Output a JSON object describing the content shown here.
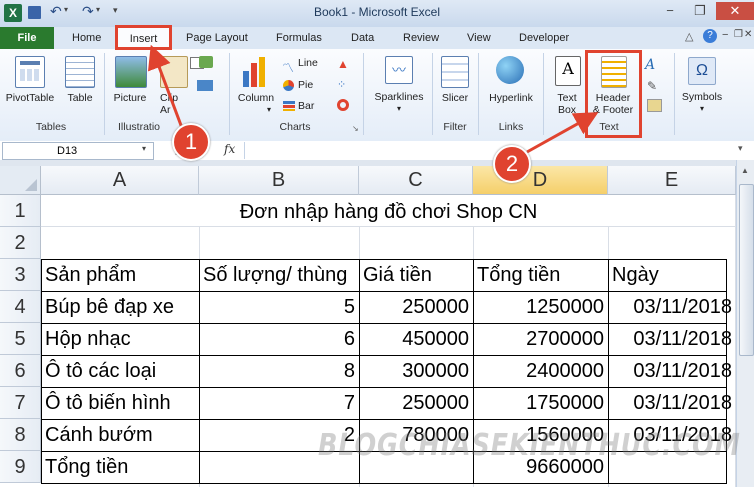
{
  "window": {
    "title": "Book1 - Microsoft Excel",
    "minimize": "−",
    "restore": "❐",
    "close": "✕"
  },
  "tabs": {
    "file": "File",
    "items": [
      "Home",
      "Insert",
      "Page Layout",
      "Formulas",
      "Data",
      "Review",
      "View",
      "Developer"
    ],
    "active": "Insert"
  },
  "ribbon": {
    "tables": {
      "group": "Tables",
      "pivot": "PivotTable",
      "table": "Table"
    },
    "illustrations": {
      "group": "Illustratio",
      "picture": "Picture",
      "clipart": "Clip Ar"
    },
    "charts": {
      "group": "Charts",
      "column": "Column",
      "line": "Line",
      "pie": "Pie",
      "bar": "Bar"
    },
    "sparklines": {
      "label": "Sparklines"
    },
    "filter": {
      "group": "Filter",
      "slicer": "Slicer"
    },
    "links": {
      "group": "Links",
      "hyperlink": "Hyperlink"
    },
    "text": {
      "group": "Text",
      "textbox_1": "Text",
      "textbox_2": "Box",
      "hf_1": "Header",
      "hf_2": "& Footer"
    },
    "symbols": {
      "label": "Symbols",
      "omega": "Ω"
    }
  },
  "formula_bar": {
    "name_box": "D13",
    "fx": "fx",
    "value": ""
  },
  "columns": [
    "A",
    "B",
    "C",
    "D",
    "E"
  ],
  "selected_column": "D",
  "rows": [
    {
      "n": "1",
      "title": "Đơn nhập hàng đồ chơi Shop CN"
    },
    {
      "n": "2"
    },
    {
      "n": "3",
      "cells": [
        "Sản phẩm",
        "Số lượng/ thùng",
        "Giá tiền",
        "Tổng tiền",
        "Ngày"
      ]
    },
    {
      "n": "4",
      "cells": [
        "Búp bê đạp xe",
        "5",
        "250000",
        "1250000",
        "03/11/2018"
      ]
    },
    {
      "n": "5",
      "cells": [
        "Hộp nhạc",
        "6",
        "450000",
        "2700000",
        "03/11/2018"
      ]
    },
    {
      "n": "6",
      "cells": [
        "Ô tô các loại",
        "8",
        "300000",
        "2400000",
        "03/11/2018"
      ]
    },
    {
      "n": "7",
      "cells": [
        "Ô tô biến hình",
        "7",
        "250000",
        "1750000",
        "03/11/2018"
      ]
    },
    {
      "n": "8",
      "cells": [
        "Cánh bướm",
        "2",
        "780000",
        "1560000",
        "03/11/2018"
      ]
    },
    {
      "n": "9",
      "cells": [
        "Tổng tiền",
        "",
        "",
        "9660000",
        ""
      ]
    }
  ],
  "callouts": {
    "one": "1",
    "two": "2"
  },
  "watermark": "BLOGCHIASEKIENTHUC.COM",
  "colors": {
    "accent": "#e0432f",
    "file_tab": "#2a7a2e"
  }
}
